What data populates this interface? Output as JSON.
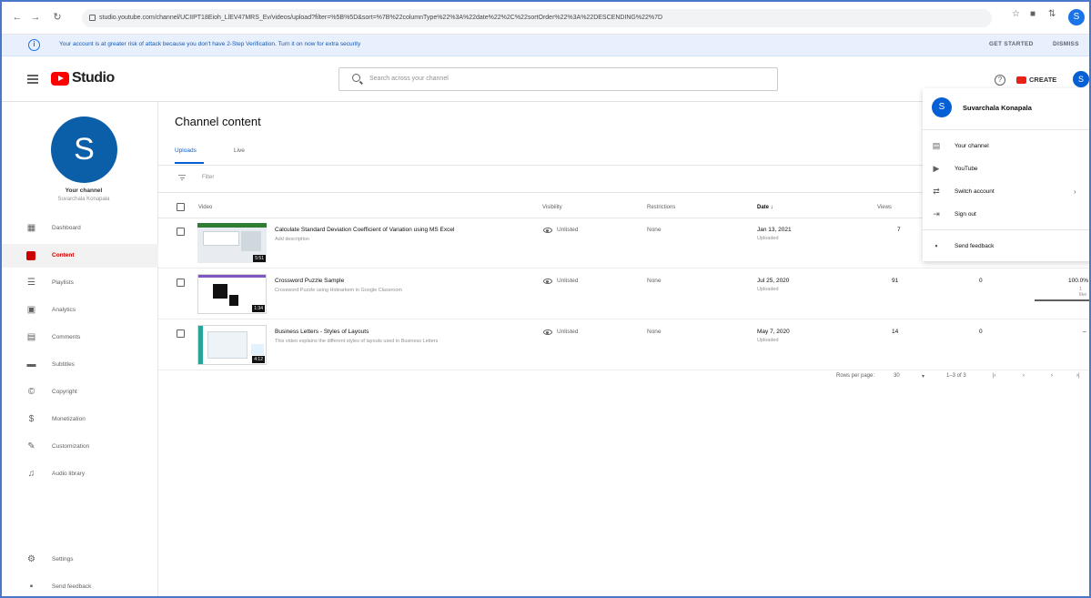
{
  "browser": {
    "url": "studio.youtube.com/channel/UCIIPT18Eioh_LlEV47MRS_Ev/videos/upload?filter=%5B%5D&sort=%7B%22columnType%22%3A%22date%22%2C%22sortOrder%22%3A%22DESCENDING%22%7D",
    "back_icon": "back-arrow-icon",
    "forward_icon": "forward-arrow-icon",
    "reload_icon": "reload-icon",
    "profile_initial": "S"
  },
  "banner": {
    "text": "Your account is at greater risk of attack because you don't have 2-Step Verification. Turn it on now for extra security",
    "get_started": "GET STARTED",
    "dismiss": "DISMISS"
  },
  "header": {
    "logo_text": "Studio",
    "search_placeholder": "Search across your channel",
    "help": "?",
    "create": "CREATE",
    "avatar_initial": "S"
  },
  "sidebar": {
    "avatar_initial": "S",
    "your_channel": "Your channel",
    "channel_name": "Suvarchala Konapala",
    "items": [
      {
        "label": "Dashboard",
        "icon": "dashboard-icon",
        "glyph": "▦"
      },
      {
        "label": "Content",
        "icon": "content-icon",
        "glyph": ""
      },
      {
        "label": "Playlists",
        "icon": "playlists-icon",
        "glyph": "☰"
      },
      {
        "label": "Analytics",
        "icon": "analytics-icon",
        "glyph": "▣"
      },
      {
        "label": "Comments",
        "icon": "comments-icon",
        "glyph": "▤"
      },
      {
        "label": "Subtitles",
        "icon": "subtitles-icon",
        "glyph": "▬"
      },
      {
        "label": "Copyright",
        "icon": "copyright-icon",
        "glyph": "©"
      },
      {
        "label": "Monetization",
        "icon": "monetization-icon",
        "glyph": "$"
      },
      {
        "label": "Customization",
        "icon": "customization-icon",
        "glyph": "✎"
      },
      {
        "label": "Audio library",
        "icon": "audio-library-icon",
        "glyph": "♫"
      }
    ],
    "bottom_items": [
      {
        "label": "Settings",
        "icon": "gear-icon",
        "glyph": "⚙"
      },
      {
        "label": "Send feedback",
        "icon": "feedback-icon",
        "glyph": "▪"
      }
    ]
  },
  "main": {
    "title": "Channel content",
    "tabs": [
      {
        "label": "Uploads"
      },
      {
        "label": "Live"
      }
    ],
    "filter_label": "Filter",
    "columns": {
      "video": "Video",
      "visibility": "Visibility",
      "restrictions": "Restrictions",
      "date": "Date ↓",
      "views": "Views"
    },
    "rows": [
      {
        "title": "Calculate Standard Deviation Coefficient of Variation using MS Excel",
        "description": "Add description",
        "duration": "5:51",
        "visibility": "Unlisted",
        "restrictions": "None",
        "date": "Jan 13, 2021",
        "date_sub": "Uploaded",
        "views": "7",
        "comments": "",
        "likes": ""
      },
      {
        "title": "Crossword Puzzle Sample",
        "description": "Crossword Puzzle using Hidearkem in Google Classroom",
        "duration": "1:34",
        "visibility": "Unlisted",
        "restrictions": "None",
        "date": "Jul 25, 2020",
        "date_sub": "Uploaded",
        "views": "91",
        "comments": "0",
        "likes": "100.0%",
        "likes_sub": "1 like"
      },
      {
        "title": "Business Letters - Styles of Layouts",
        "description": "This video explains the different styles of layouts used in Business Letters",
        "duration": "4:12",
        "visibility": "Unlisted",
        "restrictions": "None",
        "date": "May 7, 2020",
        "date_sub": "Uploaded",
        "views": "14",
        "comments": "0",
        "likes": "–"
      }
    ],
    "pagination": {
      "rows_per_page_label": "Rows per page:",
      "rows_per_page": "30",
      "range": "1–3 of 3",
      "first": "|‹",
      "prev": "‹",
      "next": "›",
      "last": "›|"
    }
  },
  "account_menu": {
    "avatar_initial": "S",
    "name": "Suvarchala Konapala",
    "items": [
      {
        "label": "Your channel",
        "icon": "channel-icon",
        "glyph": "▤"
      },
      {
        "label": "YouTube",
        "icon": "youtube-icon",
        "glyph": "▶"
      },
      {
        "label": "Switch account",
        "icon": "switch-account-icon",
        "glyph": "⇄"
      },
      {
        "label": "Sign out",
        "icon": "sign-out-icon",
        "glyph": "⇥"
      }
    ],
    "feedback": {
      "label": "Send feedback",
      "icon": "feedback-icon",
      "glyph": "▪"
    },
    "chevron": "›"
  }
}
